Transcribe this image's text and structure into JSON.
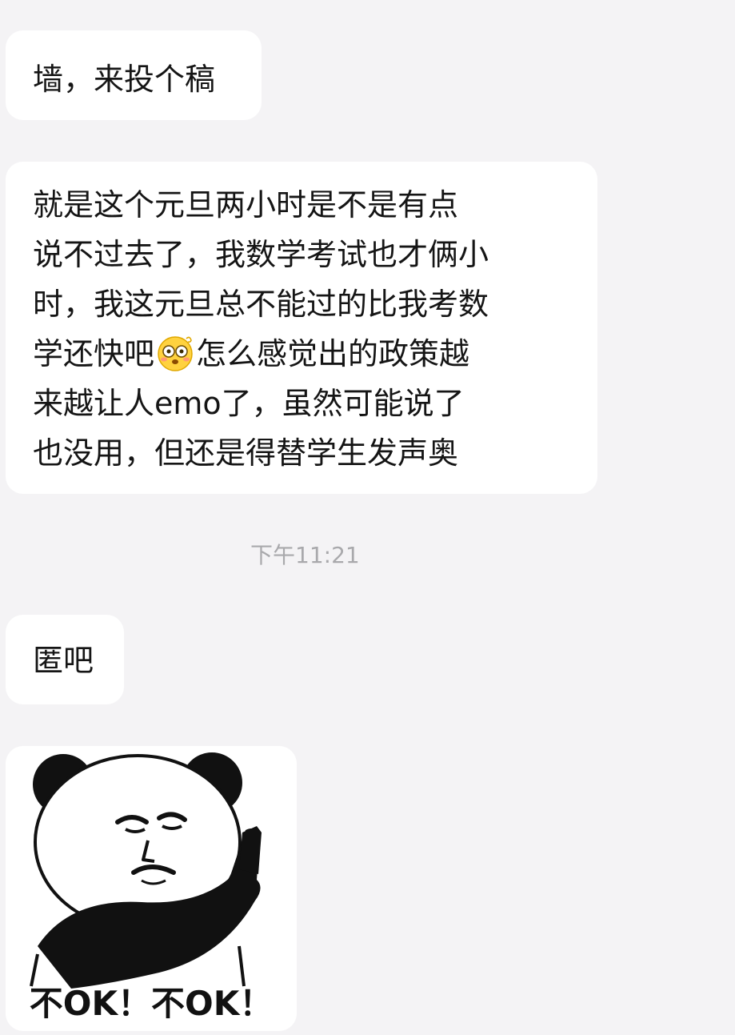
{
  "messages": [
    {
      "text": "墙，来投个稿"
    },
    {
      "lines": [
        "就是这个元旦两小时是不是有点",
        "说不过去了，我数学考试也才俩小",
        "时，我这元旦总不能过的比我考数",
        {
          "before": "学还快吧",
          "emoji": "flushed-face-icon",
          "after": "怎么感觉出的政策越"
        },
        "来越让人emo了，虽然可能说了",
        "也没用，但还是得替学生发声奥"
      ]
    },
    {
      "text": "匿吧"
    }
  ],
  "timestamp": "下午11:21",
  "sticker": {
    "caption": "不OK！不OK！",
    "icon": "panda-meme-sticker"
  }
}
